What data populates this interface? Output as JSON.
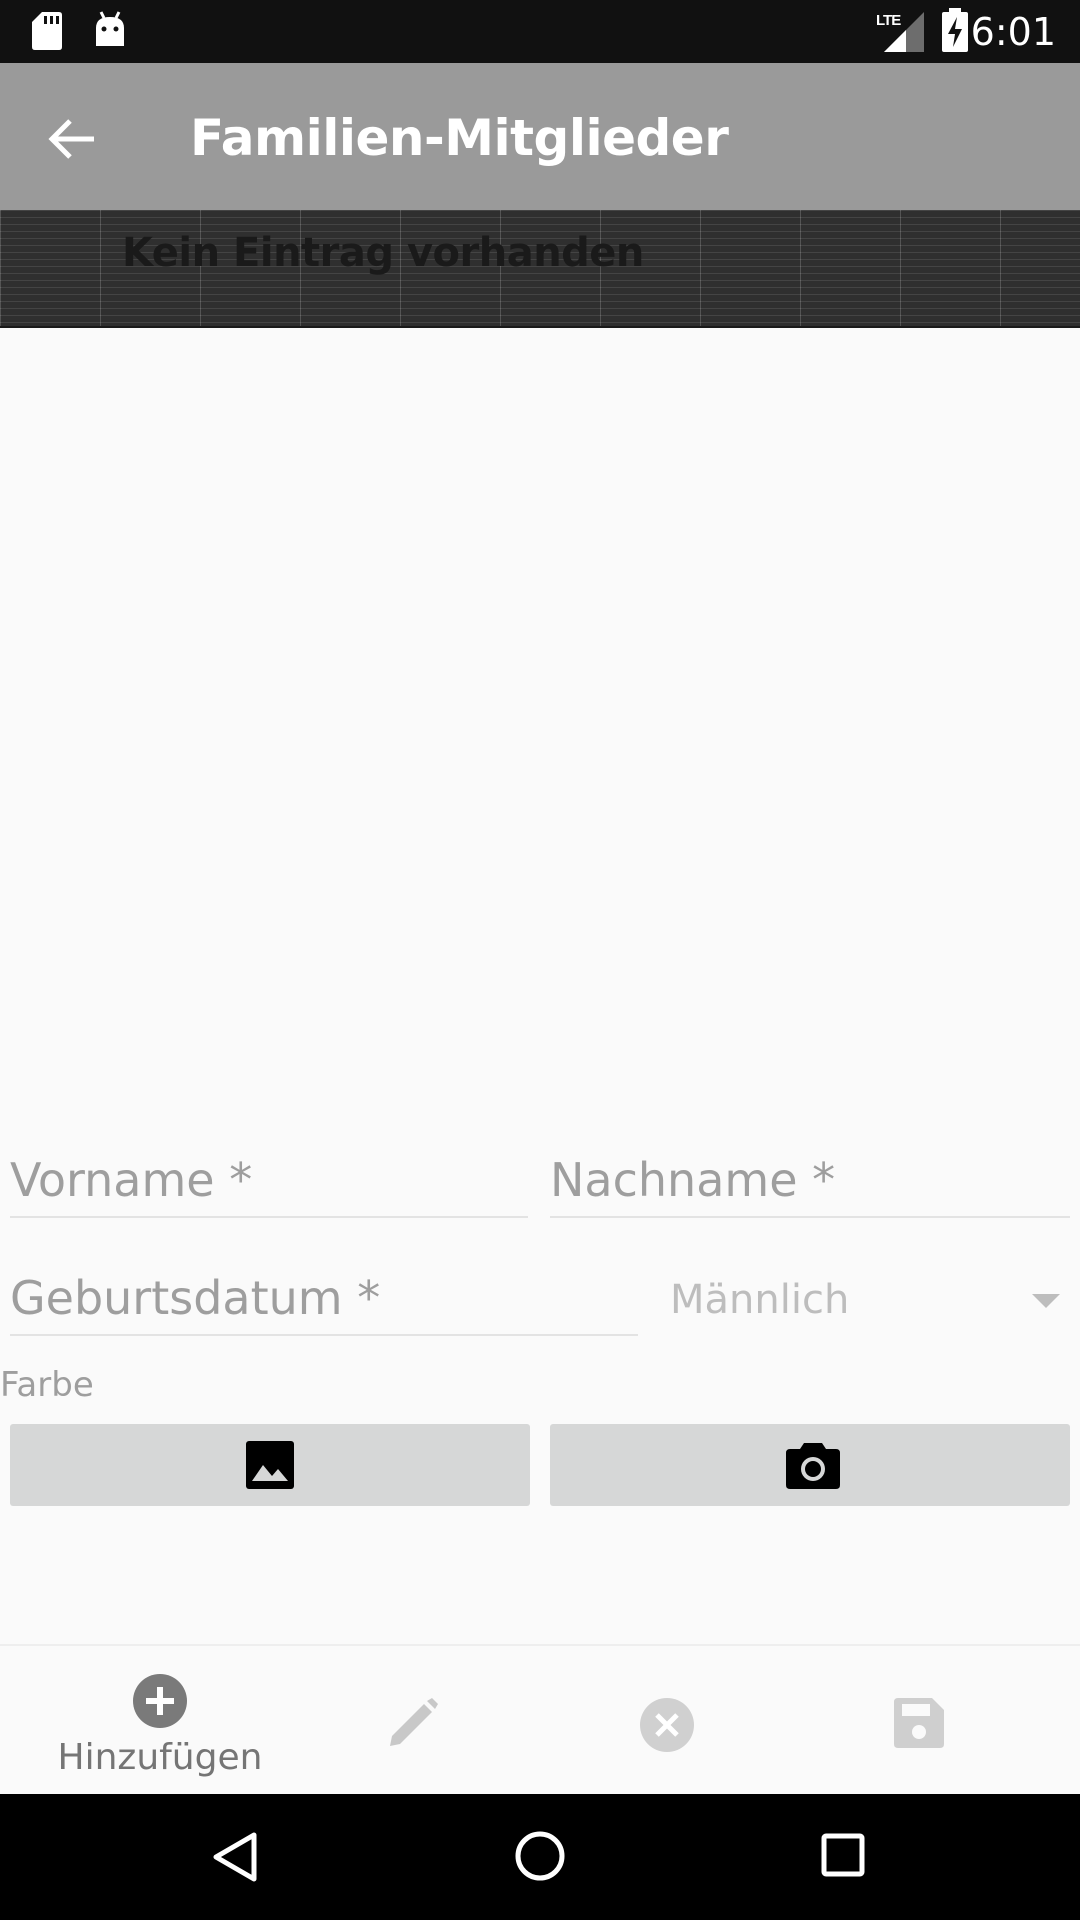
{
  "status_bar": {
    "time": "6:01",
    "network": "LTE",
    "icons": [
      "sd-card-icon",
      "android-icon",
      "lte-signal-icon",
      "battery-charging-icon"
    ]
  },
  "app_bar": {
    "title": "Familien-Mitglieder",
    "back_icon": "arrow-back-icon"
  },
  "banner": {
    "text": "Kein Eintrag vorhanden"
  },
  "form": {
    "first_name_label": "Vorname *",
    "last_name_label": "Nachname *",
    "birthdate_label": "Geburtsdatum *",
    "gender_value": "Männlich",
    "color_label": "Farbe",
    "gallery_icon": "image-icon",
    "camera_icon": "camera-icon"
  },
  "bottom_bar": {
    "add_label": "Hinzufügen",
    "add_icon": "add-circle-icon",
    "edit_icon": "pencil-icon",
    "cancel_icon": "cancel-circle-icon",
    "save_icon": "save-icon"
  },
  "nav_bar": {
    "icons": [
      "back-triangle-icon",
      "home-circle-icon",
      "recents-square-icon"
    ]
  },
  "colors": {
    "status_bar": "#111111",
    "app_bar": "#9a9a9a",
    "background": "#fafafa",
    "button": "#d6d7d7",
    "label": "#9e9e9e"
  }
}
